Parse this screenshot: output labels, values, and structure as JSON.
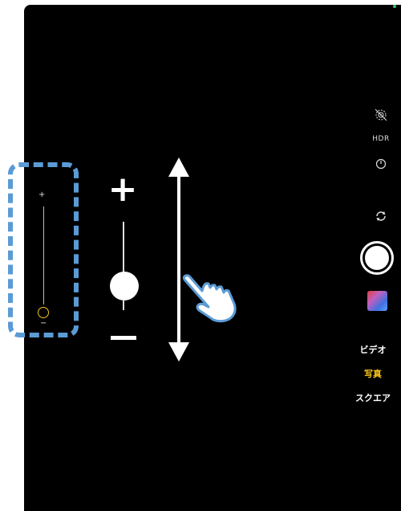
{
  "camera": {
    "hdr_label": "HDR",
    "modes": {
      "video": "ビデオ",
      "photo": "写真",
      "square": "スクエア"
    },
    "accent_color": "#f5c518",
    "highlight_color": "#5b9bd5"
  },
  "exposure_slider": {
    "plus": "+",
    "minus": "−",
    "level": 0.0
  },
  "icons": {
    "live": "live-photo-off-icon",
    "timer": "timer-icon",
    "flip": "switch-camera-icon",
    "gesture": "swipe-hand-icon",
    "arrow": "vertical-double-arrow-icon"
  }
}
